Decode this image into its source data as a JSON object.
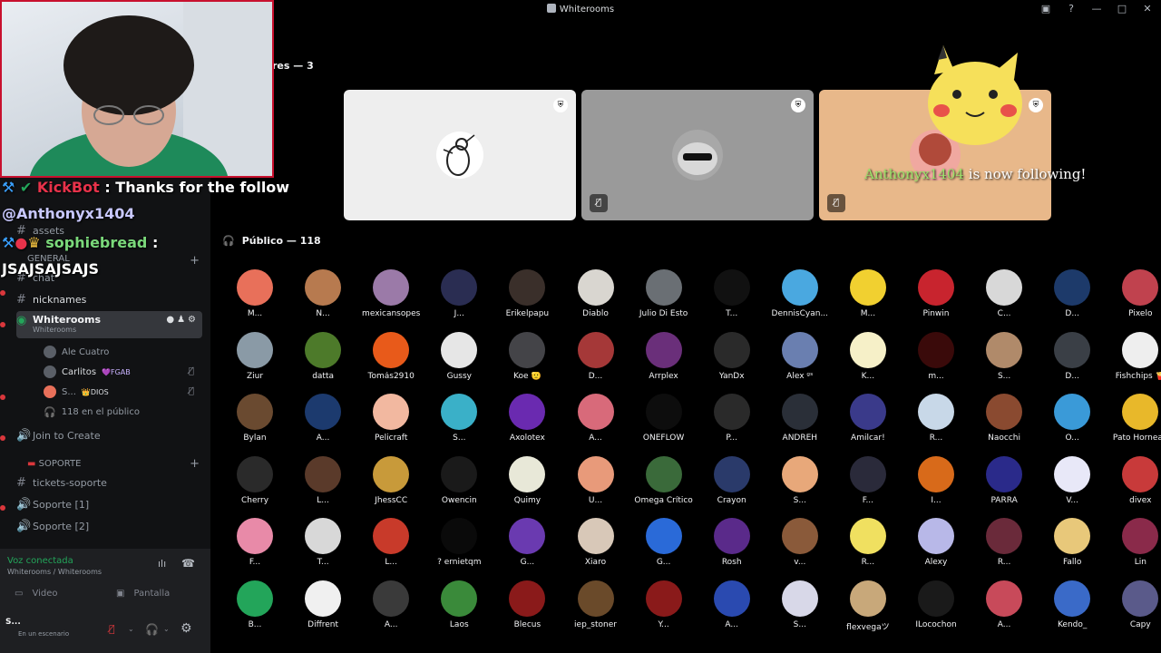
{
  "window": {
    "title": "Whiterooms"
  },
  "sidebar": {
    "category_general": "GENERAL",
    "channels_top": [
      {
        "label": "assets"
      },
      {
        "label": "chat"
      },
      {
        "label": "nicknames"
      }
    ],
    "stage": {
      "label": "Whiterooms",
      "sub": "Whiterooms"
    },
    "stage_users": [
      {
        "name": "Ale Cuatro"
      },
      {
        "name": "Carlitos",
        "badge": "💜FGAB"
      },
      {
        "name": "S...",
        "badge": "👑DIOS"
      }
    ],
    "audience_count": "118 en el público",
    "join_create": "Join to Create",
    "category_soporte": "SOPORTE",
    "soporte_channels": [
      {
        "label": "tickets-soporte"
      },
      {
        "label": "Soporte [1]"
      },
      {
        "label": "Soporte [2]"
      }
    ],
    "voice": {
      "status": "Voz conectada",
      "path": "Whiterooms / Whiterooms",
      "video": "Video",
      "screen": "Pantalla"
    },
    "user": {
      "name": "S...",
      "status": "En un escenario"
    }
  },
  "stage_area": {
    "speakers_header": "res — 3",
    "public_header": "Público — 118"
  },
  "overlay": {
    "alert_text": "is now following!",
    "alert_user": "Anthonyx1404",
    "chat": [
      {
        "user": "KickBot",
        "text": ": Thanks for the follow"
      },
      {
        "user": "",
        "text": "@Anthonyx1404"
      },
      {
        "user": "sophiebread",
        "text": ":"
      },
      {
        "user": "",
        "text": "JSAJSAJSAJS"
      }
    ]
  },
  "audience": [
    {
      "name": "M...",
      "color": "#e8705a"
    },
    {
      "name": "N...",
      "color": "#b77a4f"
    },
    {
      "name": "mexicansopes",
      "color": "#9b7aa8"
    },
    {
      "name": "J...",
      "color": "#2a2d52"
    },
    {
      "name": "Erikelpapu",
      "color": "#3a2f2a"
    },
    {
      "name": "Diablo",
      "color": "#d9d6d0"
    },
    {
      "name": "Julio Di Esto",
      "color": "#6a6f74"
    },
    {
      "name": "T...",
      "color": "#111111"
    },
    {
      "name": "DennisCyan...",
      "color": "#4aa8e0"
    },
    {
      "name": "M...",
      "color": "#f1d030"
    },
    {
      "name": "Pinwin",
      "color": "#c8242e"
    },
    {
      "name": "C...",
      "color": "#d8d8d8"
    },
    {
      "name": "D...",
      "color": "#1d3a6a"
    },
    {
      "name": "Pixelo",
      "color": "#c0424e"
    },
    {
      "name": "Ziur",
      "color": "#8a9aa6"
    },
    {
      "name": "datta",
      "color": "#4d7a2a"
    },
    {
      "name": "Tomás2910",
      "color": "#e85a1a"
    },
    {
      "name": "Gussy",
      "color": "#e6e6e6"
    },
    {
      "name": "Koe 🫡",
      "color": "#444448"
    },
    {
      "name": "D...",
      "color": "#a53838"
    },
    {
      "name": "Arrplex",
      "color": "#6a2f7a"
    },
    {
      "name": "YanDx",
      "color": "#2a2a2a"
    },
    {
      "name": "Alex ᶢˢ",
      "color": "#6a7fb0"
    },
    {
      "name": "K...",
      "color": "#f6f0c8"
    },
    {
      "name": "m...",
      "color": "#3a0a0a"
    },
    {
      "name": "S...",
      "color": "#b08a6a"
    },
    {
      "name": "D...",
      "color": "#3a3f46"
    },
    {
      "name": "Fishchips 🍟",
      "color": "#eeeeee"
    },
    {
      "name": "Bylan",
      "color": "#6a4a30"
    },
    {
      "name": "A...",
      "color": "#1c3a6e"
    },
    {
      "name": "Pelicraft",
      "color": "#f2b8a0"
    },
    {
      "name": "S...",
      "color": "#3ab0c8"
    },
    {
      "name": "Axolotex",
      "color": "#6a2ab0"
    },
    {
      "name": "A...",
      "color": "#d86a7a"
    },
    {
      "name": "ONEFLOW",
      "color": "#0d0d0d"
    },
    {
      "name": "P...",
      "color": "#2a2a2a"
    },
    {
      "name": "ANDREH",
      "color": "#2a2f38"
    },
    {
      "name": "Amilcar!",
      "color": "#3a3a8a"
    },
    {
      "name": "R...",
      "color": "#c8d8e8"
    },
    {
      "name": "Naocchi",
      "color": "#8a4a30"
    },
    {
      "name": "O...",
      "color": "#3a9ad8"
    },
    {
      "name": "Pato Hornead",
      "color": "#e8b82a"
    },
    {
      "name": "Cherry",
      "color": "#2a2a2a"
    },
    {
      "name": "L...",
      "color": "#5a3a2a"
    },
    {
      "name": "JhessCC",
      "color": "#c89a3a"
    },
    {
      "name": "Owencin",
      "color": "#1a1a1a"
    },
    {
      "name": "Quimy",
      "color": "#e8e8d8"
    },
    {
      "name": "U...",
      "color": "#e89a7a"
    },
    {
      "name": "Omega Crítico",
      "color": "#3a6a3a"
    },
    {
      "name": "Crayon",
      "color": "#2a3a6a"
    },
    {
      "name": "S...",
      "color": "#e8a87a"
    },
    {
      "name": "F...",
      "color": "#2a2a3a"
    },
    {
      "name": "I...",
      "color": "#d86a1a"
    },
    {
      "name": "PARRA",
      "color": "#2a2a8a"
    },
    {
      "name": "V...",
      "color": "#e8e8f8"
    },
    {
      "name": "divex",
      "color": "#c83a3a"
    },
    {
      "name": "F...",
      "color": "#e88aa8"
    },
    {
      "name": "T...",
      "color": "#d8d8d8"
    },
    {
      "name": "L...",
      "color": "#c83a2a"
    },
    {
      "name": "? ernietqm",
      "color": "#0a0a0a"
    },
    {
      "name": "G...",
      "color": "#6a3ab0"
    },
    {
      "name": "Xiaro",
      "color": "#d8c8b8"
    },
    {
      "name": "G...",
      "color": "#2a6ad8"
    },
    {
      "name": "Rosh",
      "color": "#5a2a8a"
    },
    {
      "name": "v...",
      "color": "#8a5a3a"
    },
    {
      "name": "R...",
      "color": "#f0e060"
    },
    {
      "name": "Alexy",
      "color": "#b8b8e8"
    },
    {
      "name": "R...",
      "color": "#6a2a3a"
    },
    {
      "name": "Fallo",
      "color": "#e8c87a"
    },
    {
      "name": "Lin",
      "color": "#8a2a4a"
    },
    {
      "name": "B...",
      "color": "#23a55a"
    },
    {
      "name": "Diffrent",
      "color": "#f0f0f0"
    },
    {
      "name": "A...",
      "color": "#3a3a3a"
    },
    {
      "name": "Laos",
      "color": "#3a8a3a"
    },
    {
      "name": "Blecus",
      "color": "#8a1a1a"
    },
    {
      "name": "iep_stoner",
      "color": "#6a4a2a"
    },
    {
      "name": "Y...",
      "color": "#8a1a1a"
    },
    {
      "name": "A...",
      "color": "#2a4ab0"
    },
    {
      "name": "S...",
      "color": "#d8d8e8"
    },
    {
      "name": "flexvegaツ",
      "color": "#c8a87a"
    },
    {
      "name": "ILocochon",
      "color": "#1a1a1a"
    },
    {
      "name": "A...",
      "color": "#c84a5a"
    },
    {
      "name": "Kendo_",
      "color": "#3a6ac8"
    },
    {
      "name": "Capy",
      "color": "#5a5a8a"
    }
  ]
}
